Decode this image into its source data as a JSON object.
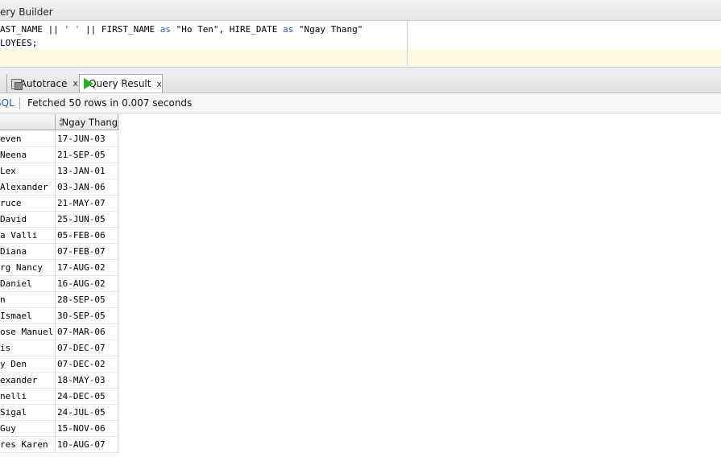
{
  "top_tab": {
    "label": "ery Builder"
  },
  "editor": {
    "line1": {
      "tokens": [
        {
          "text": "AST_NAME || ",
          "style": "plain"
        },
        {
          "text": "' '",
          "style": "string"
        },
        {
          "text": " || FIRST_NAME ",
          "style": "plain"
        },
        {
          "text": "as",
          "style": "keyword"
        },
        {
          "text": " \"Ho Ten\", HIRE_DATE ",
          "style": "plain"
        },
        {
          "text": "as",
          "style": "keyword"
        },
        {
          "text": " \"Ngay Thang\"",
          "style": "plain"
        }
      ]
    },
    "line2": "LOYEES;"
  },
  "result_tabs": {
    "autotrace": {
      "label": "Autotrace",
      "close": "x"
    },
    "query_result": {
      "label": "Query Result",
      "close": "x"
    }
  },
  "status": {
    "sql_link": "SQL",
    "message": "Fetched 50 rows in 0.007 seconds"
  },
  "grid": {
    "columns": [
      "",
      "Ngay Thang"
    ],
    "rows": [
      [
        "even",
        "17-JUN-03"
      ],
      [
        " Neena",
        "21-SEP-05"
      ],
      [
        " Lex",
        "13-JAN-01"
      ],
      [
        "Alexander",
        "03-JAN-06"
      ],
      [
        "ruce",
        "21-MAY-07"
      ],
      [
        "David",
        "25-JUN-05"
      ],
      [
        "a Valli",
        "05-FEB-06"
      ],
      [
        " Diana",
        "07-FEB-07"
      ],
      [
        "rg Nancy",
        "17-AUG-02"
      ],
      [
        "Daniel",
        "16-AUG-02"
      ],
      [
        "n",
        "28-SEP-05"
      ],
      [
        " Ismael",
        "30-SEP-05"
      ],
      [
        "ose Manuel",
        "07-MAR-06"
      ],
      [
        "is",
        "07-DEC-07"
      ],
      [
        "y Den",
        "07-DEC-02"
      ],
      [
        "exander",
        "18-MAY-03"
      ],
      [
        "nelli",
        "24-DEC-05"
      ],
      [
        "Sigal",
        "24-JUL-05"
      ],
      [
        "Guy",
        "15-NOV-06"
      ],
      [
        "res Karen",
        "10-AUG-07"
      ]
    ]
  }
}
